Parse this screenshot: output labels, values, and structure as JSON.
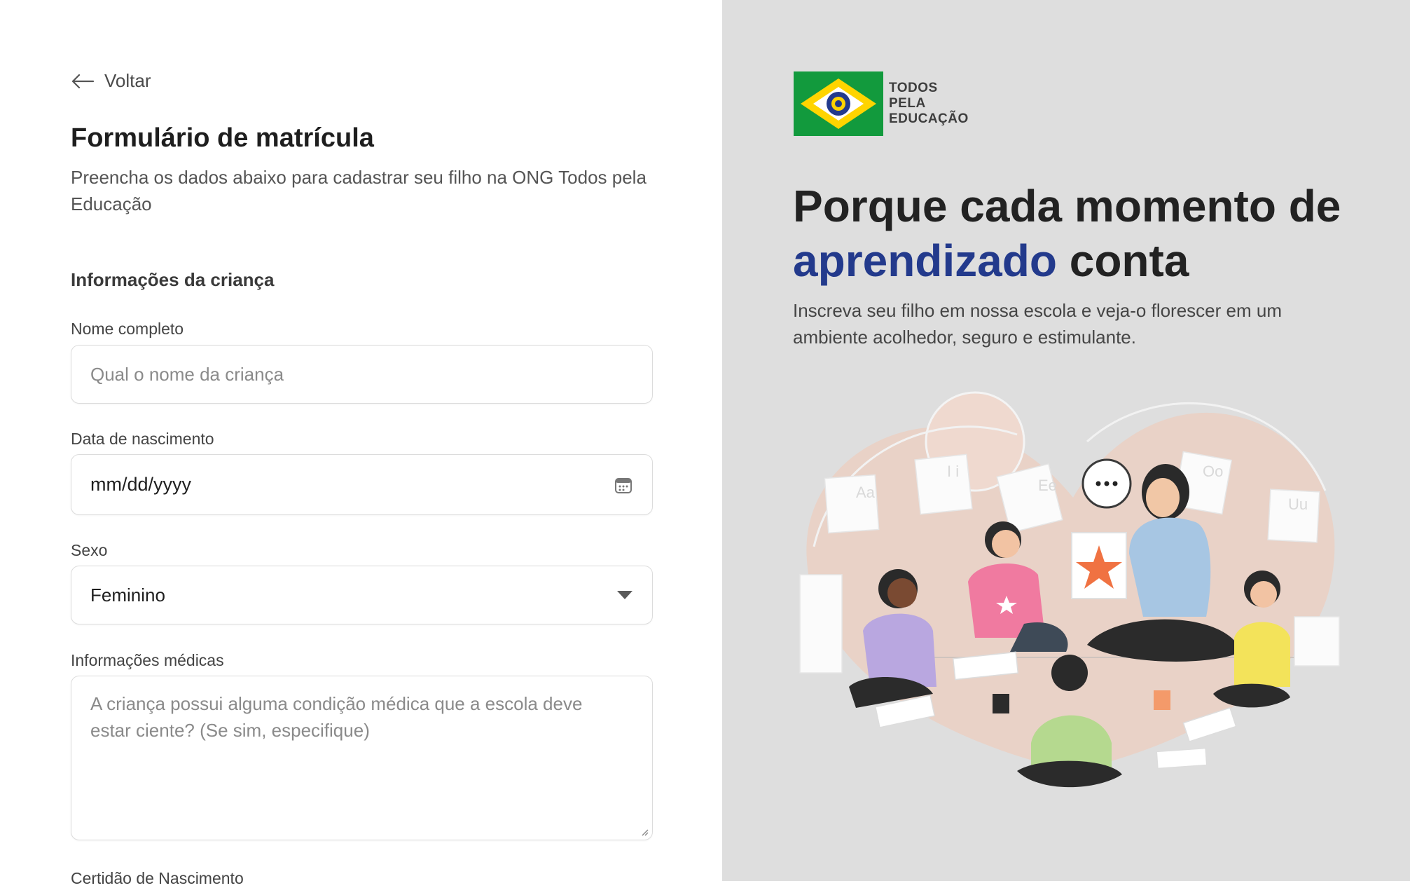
{
  "back": {
    "label": "Voltar"
  },
  "form": {
    "title": "Formulário de matrícula",
    "subtitle": "Preencha os dados abaixo para cadastrar seu filho na ONG Todos pela Educação",
    "section_child": "Informações da criança",
    "fields": {
      "name": {
        "label": "Nome completo",
        "placeholder": "Qual o nome da criança"
      },
      "birthdate": {
        "label": "Data de nascimento",
        "value": "mm/dd/yyyy",
        "icon": "calendar-icon"
      },
      "sex": {
        "label": "Sexo",
        "value": "Feminino",
        "icon": "caret-down-icon"
      },
      "medical": {
        "label": "Informações médicas",
        "placeholder": "A criança possui alguma condição médica que a escola deve estar ciente? (Se sim, especifique)"
      },
      "certificate": {
        "label": "Certidão de Nascimento"
      }
    }
  },
  "brand": {
    "logo_lines": [
      "TODOS",
      "PELA",
      "EDUCAÇÃO"
    ],
    "headline_pre": "Porque cada momento de ",
    "headline_highlight": "aprendizado",
    "headline_post": " conta",
    "tagline": "Inscreva seu filho em nossa escola e veja-o florescer em um ambiente acolhedor, seguro e estimulante."
  },
  "colors": {
    "highlight": "#233a8c",
    "panel_bg": "#dedede",
    "flag_green": "#129a3d",
    "flag_yellow": "#ffd400",
    "flag_blue": "#233a8c"
  }
}
